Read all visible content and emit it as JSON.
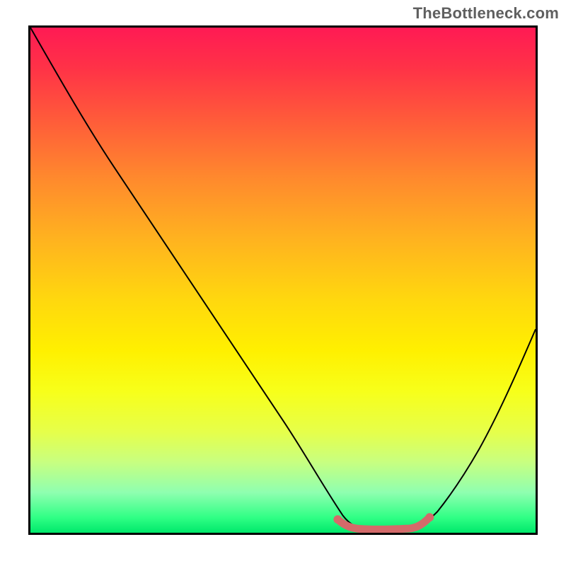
{
  "watermark": "TheBottleneck.com",
  "chart_data": {
    "type": "line",
    "title": "",
    "xlabel": "",
    "ylabel": "",
    "xlim": [
      0,
      100
    ],
    "ylim": [
      0,
      100
    ],
    "x": [
      0,
      6,
      12,
      18,
      24,
      30,
      36,
      42,
      48,
      54,
      58,
      62,
      66,
      70,
      74,
      78,
      82,
      86,
      90,
      94,
      98,
      100
    ],
    "values": [
      100,
      92,
      84,
      75,
      66,
      57,
      48,
      39,
      30,
      21,
      14,
      8,
      3,
      1,
      1,
      1,
      4,
      10,
      18,
      28,
      40,
      46
    ],
    "highlight_segment": {
      "x_start": 60,
      "x_end": 78,
      "color": "#d86b6b"
    },
    "gradient_stops": [
      {
        "pos": 0.0,
        "color": "#ff1a54"
      },
      {
        "pos": 0.3,
        "color": "#ff8a2d"
      },
      {
        "pos": 0.6,
        "color": "#fff000"
      },
      {
        "pos": 0.9,
        "color": "#8fffb0"
      },
      {
        "pos": 1.0,
        "color": "#00e86b"
      }
    ]
  }
}
